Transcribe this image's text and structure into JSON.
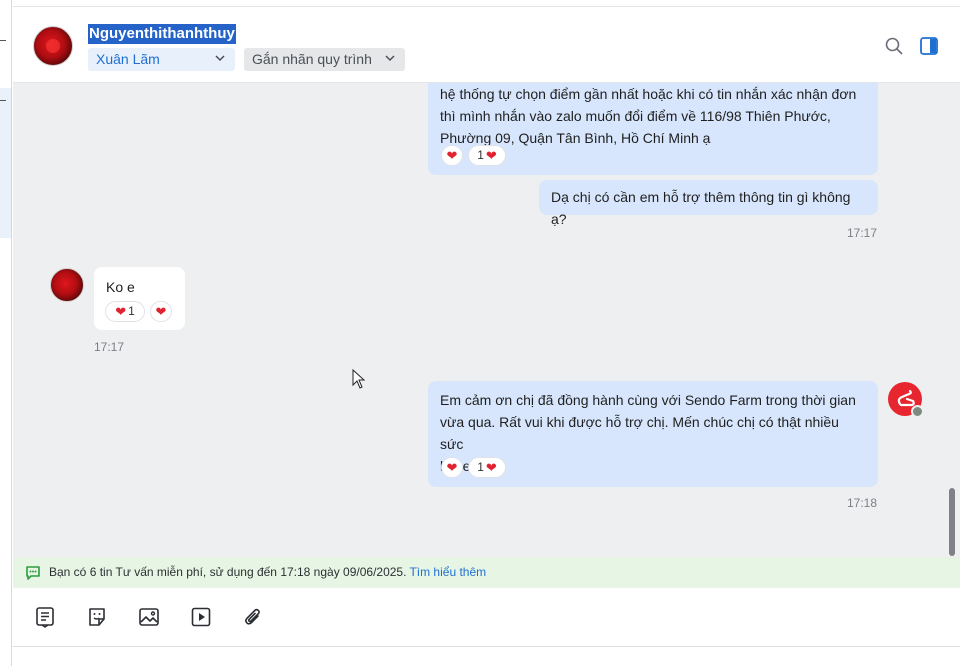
{
  "header": {
    "contact_name": "Nguyenthithanhthuy",
    "assignee": "Xuân Lãm",
    "tag_placeholder": "Gắn nhãn quy trình"
  },
  "messages": [
    {
      "from": "me",
      "lines": [
        "hệ thống tự chọn điểm gần nhất hoặc khi có tin nhắn xác nhận đơn",
        "thì mình nhắn vào zalo muốn đổi điểm về 116/98 Thiên Phước,",
        "Phường 09, Quận Tân Bình, Hồ Chí Minh ạ"
      ],
      "reaction_count": "1"
    },
    {
      "from": "me",
      "text": "Dạ chị có cần em hỗ trợ thêm thông tin gì không ạ?",
      "time": "17:17"
    },
    {
      "from": "them",
      "text": "Ko e",
      "reaction_count": "1",
      "time": "17:17"
    },
    {
      "from": "me",
      "lines": [
        "Em cảm ơn chị đã đồng hành cùng với Sendo Farm trong thời gian",
        "vừa qua. Rất vui khi được hỗ trợ chị. Mến chúc chị có thật nhiều sức",
        "khỏe."
      ],
      "reaction_count": "1",
      "time": "17:18"
    }
  ],
  "notice": {
    "text": "Bạn có 6 tin Tư vấn miễn phí, sử dụng đến 17:18 ngày 09/06/2025.",
    "link": "Tìm hiểu thêm"
  },
  "toolbar": {
    "icons": [
      "template-icon",
      "sticker-icon",
      "image-icon",
      "video-icon",
      "attachment-icon"
    ]
  },
  "colors": {
    "accent": "#1f6fd1",
    "bubble_me": "#d7e6fc",
    "chat_bg": "#eeeff1",
    "notice_bg": "#e7f6e4",
    "heart": "#e0232e"
  }
}
